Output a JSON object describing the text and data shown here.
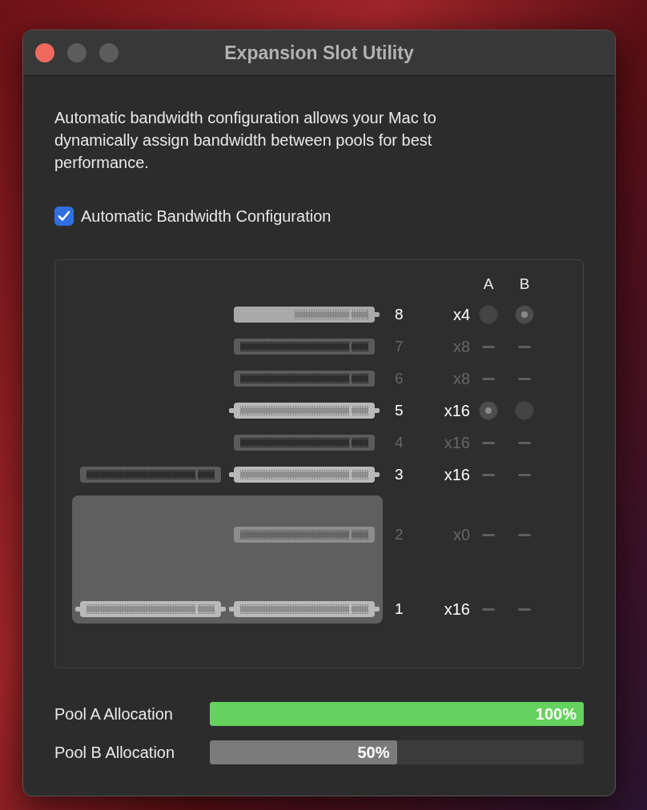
{
  "window": {
    "title": "Expansion Slot Utility"
  },
  "description": "Automatic bandwidth configuration allows your Mac to dynamically assign bandwidth between pools for best performance.",
  "automatic": {
    "label": "Automatic Bandwidth Configuration",
    "checked": true
  },
  "columns": [
    "A",
    "B"
  ],
  "slots": [
    {
      "number": "8",
      "lanes": "x4",
      "active": true,
      "kind": "card",
      "pooled": false,
      "pool_a": {
        "kind": "radio",
        "selected": false
      },
      "pool_b": {
        "kind": "radio",
        "selected": true
      }
    },
    {
      "number": "7",
      "lanes": "x8",
      "active": false,
      "kind": "disabled",
      "pooled": false,
      "pool_a": {
        "kind": "none"
      },
      "pool_b": {
        "kind": "none"
      }
    },
    {
      "number": "6",
      "lanes": "x8",
      "active": false,
      "kind": "disabled",
      "pooled": false,
      "pool_a": {
        "kind": "none"
      },
      "pool_b": {
        "kind": "none"
      }
    },
    {
      "number": "5",
      "lanes": "x16",
      "active": true,
      "kind": "populated",
      "pooled": false,
      "pool_a": {
        "kind": "radio",
        "selected": true
      },
      "pool_b": {
        "kind": "radio",
        "selected": false
      }
    },
    {
      "number": "4",
      "lanes": "x16",
      "active": false,
      "kind": "disabled",
      "pooled": false,
      "pool_a": {
        "kind": "none"
      },
      "pool_b": {
        "kind": "none"
      }
    },
    {
      "number": "3",
      "lanes": "x16",
      "active": true,
      "kind": "populated",
      "pooled": false,
      "companion": {
        "kind": "disabled"
      },
      "pool_a": {
        "kind": "none"
      },
      "pool_b": {
        "kind": "none"
      }
    },
    {
      "number": "2",
      "lanes": "x0",
      "active": false,
      "kind": "open",
      "pooled": true,
      "pool_a": {
        "kind": "none"
      },
      "pool_b": {
        "kind": "none"
      }
    },
    {
      "number": "1",
      "lanes": "x16",
      "active": true,
      "kind": "populated",
      "pooled": true,
      "companion": {
        "kind": "populated"
      },
      "pool_a": {
        "kind": "none"
      },
      "pool_b": {
        "kind": "none"
      }
    }
  ],
  "pools": [
    {
      "label": "Pool A Allocation",
      "level": 1,
      "reading": "100%",
      "color": "#65d15f"
    },
    {
      "label": "Pool B Allocation",
      "level": 0.5,
      "reading": "50%",
      "color": "#7b7b7b"
    }
  ]
}
